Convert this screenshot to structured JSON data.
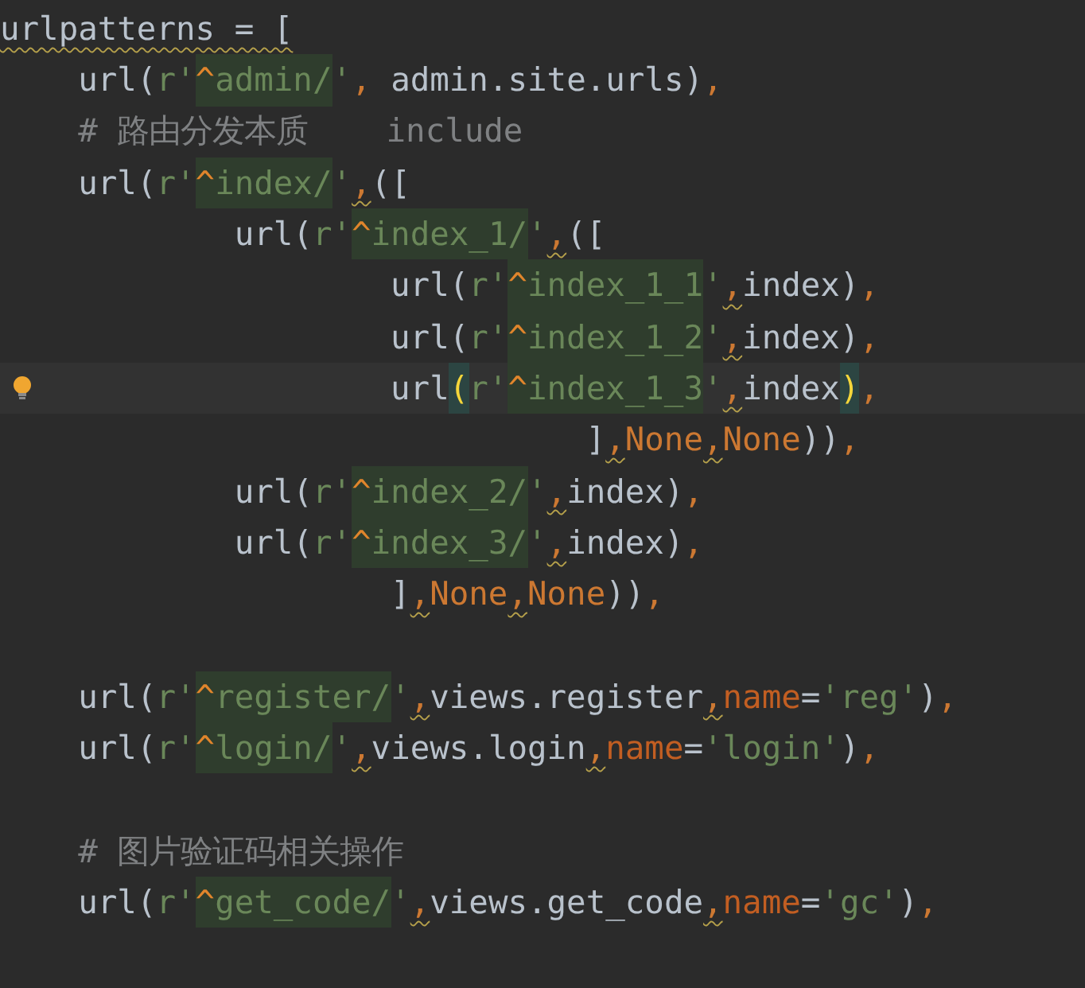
{
  "editor": {
    "lines": [
      {
        "kind": "code",
        "current": false,
        "bulb": false,
        "tokens": [
          {
            "text": "urlpatterns = [",
            "kind": "warn-text"
          }
        ]
      },
      {
        "kind": "code",
        "current": false,
        "bulb": false,
        "tokens": [
          {
            "text": "    url(",
            "kind": "text"
          },
          {
            "text": "r'",
            "kind": "string"
          },
          {
            "text": "^",
            "kind": "anchor"
          },
          {
            "text": "admin/",
            "kind": "regex"
          },
          {
            "text": "'",
            "kind": "string"
          },
          {
            "text": ", ",
            "kind": "punct"
          },
          {
            "text": "admin.site.urls)",
            "kind": "text"
          },
          {
            "text": ",",
            "kind": "punct"
          }
        ]
      },
      {
        "kind": "code",
        "current": false,
        "bulb": false,
        "tokens": [
          {
            "text": "    # 路由分发本质    include",
            "kind": "comment"
          }
        ]
      },
      {
        "kind": "code",
        "current": false,
        "bulb": false,
        "tokens": [
          {
            "text": "    url(",
            "kind": "text"
          },
          {
            "text": "r'",
            "kind": "string"
          },
          {
            "text": "^",
            "kind": "anchor"
          },
          {
            "text": "index/",
            "kind": "regex"
          },
          {
            "text": "'",
            "kind": "string"
          },
          {
            "text": ",",
            "kind": "warn-comma"
          },
          {
            "text": "([",
            "kind": "text"
          }
        ]
      },
      {
        "kind": "code",
        "current": false,
        "bulb": false,
        "tokens": [
          {
            "text": "            url(",
            "kind": "text"
          },
          {
            "text": "r'",
            "kind": "string"
          },
          {
            "text": "^",
            "kind": "anchor"
          },
          {
            "text": "index_1/",
            "kind": "regex"
          },
          {
            "text": "'",
            "kind": "string"
          },
          {
            "text": ",",
            "kind": "warn-comma"
          },
          {
            "text": "([",
            "kind": "text"
          }
        ]
      },
      {
        "kind": "code",
        "current": false,
        "bulb": false,
        "tokens": [
          {
            "text": "                    url(",
            "kind": "text"
          },
          {
            "text": "r'",
            "kind": "string"
          },
          {
            "text": "^",
            "kind": "anchor"
          },
          {
            "text": "index_1_1",
            "kind": "regex"
          },
          {
            "text": "'",
            "kind": "string"
          },
          {
            "text": ",",
            "kind": "warn-comma"
          },
          {
            "text": "index)",
            "kind": "text"
          },
          {
            "text": ",",
            "kind": "punct"
          }
        ]
      },
      {
        "kind": "code",
        "current": false,
        "bulb": false,
        "tokens": [
          {
            "text": "                    url(",
            "kind": "text"
          },
          {
            "text": "r'",
            "kind": "string"
          },
          {
            "text": "^",
            "kind": "anchor"
          },
          {
            "text": "index_1_2",
            "kind": "regex"
          },
          {
            "text": "'",
            "kind": "string"
          },
          {
            "text": ",",
            "kind": "warn-comma"
          },
          {
            "text": "index)",
            "kind": "text"
          },
          {
            "text": ",",
            "kind": "punct"
          }
        ]
      },
      {
        "kind": "code",
        "current": true,
        "bulb": true,
        "tokens": [
          {
            "text": "                    url",
            "kind": "text"
          },
          {
            "text": "(",
            "kind": "brace-match"
          },
          {
            "text": "r'",
            "kind": "string"
          },
          {
            "text": "^",
            "kind": "anchor"
          },
          {
            "text": "index_1_3",
            "kind": "regex"
          },
          {
            "text": "'",
            "kind": "string"
          },
          {
            "text": ",",
            "kind": "warn-comma"
          },
          {
            "text": "index",
            "kind": "text"
          },
          {
            "text": ")",
            "kind": "brace-match"
          },
          {
            "text": ",",
            "kind": "punct"
          }
        ]
      },
      {
        "kind": "code",
        "current": false,
        "bulb": false,
        "tokens": [
          {
            "text": "                              ]",
            "kind": "text"
          },
          {
            "text": ",",
            "kind": "warn-comma"
          },
          {
            "text": "None",
            "kind": "keyword"
          },
          {
            "text": ",",
            "kind": "warn-comma"
          },
          {
            "text": "None",
            "kind": "keyword"
          },
          {
            "text": "))",
            "kind": "text"
          },
          {
            "text": ",",
            "kind": "punct"
          }
        ]
      },
      {
        "kind": "code",
        "current": false,
        "bulb": false,
        "tokens": [
          {
            "text": "            url(",
            "kind": "text"
          },
          {
            "text": "r'",
            "kind": "string"
          },
          {
            "text": "^",
            "kind": "anchor"
          },
          {
            "text": "index_2/",
            "kind": "regex"
          },
          {
            "text": "'",
            "kind": "string"
          },
          {
            "text": ",",
            "kind": "warn-comma"
          },
          {
            "text": "index)",
            "kind": "text"
          },
          {
            "text": ",",
            "kind": "punct"
          }
        ]
      },
      {
        "kind": "code",
        "current": false,
        "bulb": false,
        "tokens": [
          {
            "text": "            url(",
            "kind": "text"
          },
          {
            "text": "r'",
            "kind": "string"
          },
          {
            "text": "^",
            "kind": "anchor"
          },
          {
            "text": "index_3/",
            "kind": "regex"
          },
          {
            "text": "'",
            "kind": "string"
          },
          {
            "text": ",",
            "kind": "warn-comma"
          },
          {
            "text": "index)",
            "kind": "text"
          },
          {
            "text": ",",
            "kind": "punct"
          }
        ]
      },
      {
        "kind": "code",
        "current": false,
        "bulb": false,
        "tokens": [
          {
            "text": "                    ]",
            "kind": "text"
          },
          {
            "text": ",",
            "kind": "warn-comma"
          },
          {
            "text": "None",
            "kind": "keyword"
          },
          {
            "text": ",",
            "kind": "warn-comma"
          },
          {
            "text": "None",
            "kind": "keyword"
          },
          {
            "text": "))",
            "kind": "text"
          },
          {
            "text": ",",
            "kind": "punct"
          }
        ]
      },
      {
        "kind": "blank"
      },
      {
        "kind": "code",
        "current": false,
        "bulb": false,
        "tokens": [
          {
            "text": "    url(",
            "kind": "text"
          },
          {
            "text": "r'",
            "kind": "string"
          },
          {
            "text": "^",
            "kind": "anchor"
          },
          {
            "text": "register/",
            "kind": "regex"
          },
          {
            "text": "'",
            "kind": "string"
          },
          {
            "text": ",",
            "kind": "warn-comma"
          },
          {
            "text": "views.register",
            "kind": "text"
          },
          {
            "text": ",",
            "kind": "warn-comma"
          },
          {
            "text": "name",
            "kind": "param"
          },
          {
            "text": "=",
            "kind": "text"
          },
          {
            "text": "'reg'",
            "kind": "string"
          },
          {
            "text": ")",
            "kind": "text"
          },
          {
            "text": ",",
            "kind": "punct"
          }
        ]
      },
      {
        "kind": "code",
        "current": false,
        "bulb": false,
        "tokens": [
          {
            "text": "    url(",
            "kind": "text"
          },
          {
            "text": "r'",
            "kind": "string"
          },
          {
            "text": "^",
            "kind": "anchor"
          },
          {
            "text": "login/",
            "kind": "regex"
          },
          {
            "text": "'",
            "kind": "string"
          },
          {
            "text": ",",
            "kind": "warn-comma"
          },
          {
            "text": "views.login",
            "kind": "text"
          },
          {
            "text": ",",
            "kind": "warn-comma"
          },
          {
            "text": "name",
            "kind": "param"
          },
          {
            "text": "=",
            "kind": "text"
          },
          {
            "text": "'login'",
            "kind": "string"
          },
          {
            "text": ")",
            "kind": "text"
          },
          {
            "text": ",",
            "kind": "punct"
          }
        ]
      },
      {
        "kind": "blank"
      },
      {
        "kind": "code",
        "current": false,
        "bulb": false,
        "tokens": [
          {
            "text": "    # 图片验证码相关操作",
            "kind": "comment"
          }
        ]
      },
      {
        "kind": "code",
        "current": false,
        "bulb": false,
        "tokens": [
          {
            "text": "    url(",
            "kind": "text"
          },
          {
            "text": "r'",
            "kind": "string"
          },
          {
            "text": "^",
            "kind": "anchor"
          },
          {
            "text": "get_code/",
            "kind": "regex"
          },
          {
            "text": "'",
            "kind": "string"
          },
          {
            "text": ",",
            "kind": "warn-comma"
          },
          {
            "text": "views.get_code",
            "kind": "text"
          },
          {
            "text": ",",
            "kind": "warn-comma"
          },
          {
            "text": "name",
            "kind": "param"
          },
          {
            "text": "=",
            "kind": "text"
          },
          {
            "text": "'gc'",
            "kind": "string"
          },
          {
            "text": ")",
            "kind": "text"
          },
          {
            "text": ",",
            "kind": "punct"
          }
        ]
      }
    ]
  }
}
